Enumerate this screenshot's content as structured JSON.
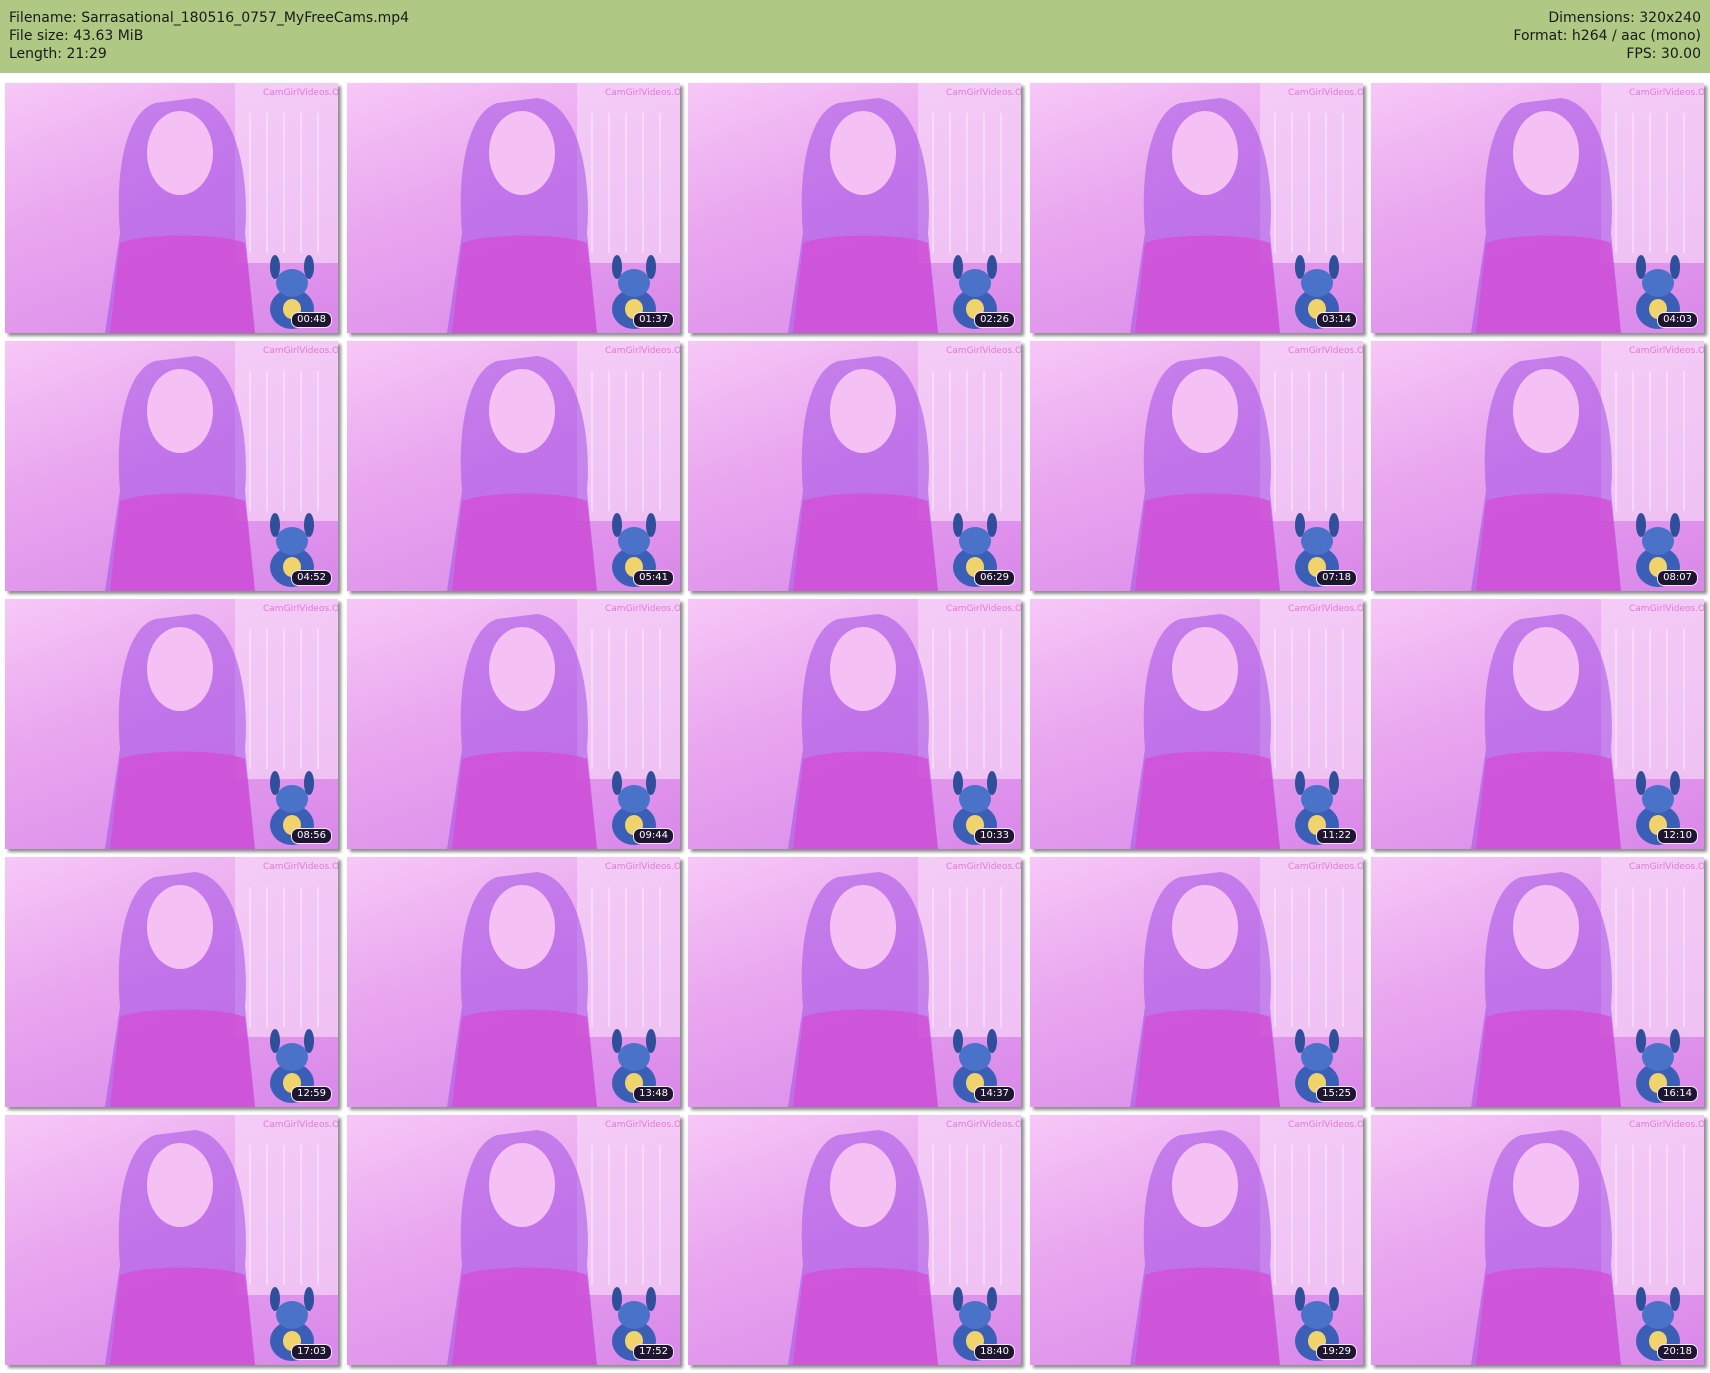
{
  "header": {
    "filename": "Filename: Sarrasational_180516_0757_MyFreeCams.mp4",
    "filesize": "File size: 43.63 MiB",
    "length": "Length: 21:29",
    "dimensions": "Dimensions: 320x240",
    "format": "Format: h264 / aac (mono)",
    "fps": "FPS: 30.00"
  },
  "thumbnails": [
    {
      "time": "00:48"
    },
    {
      "time": "01:37"
    },
    {
      "time": "02:26"
    },
    {
      "time": "03:14"
    },
    {
      "time": "04:03"
    },
    {
      "time": "04:52"
    },
    {
      "time": "05:41"
    },
    {
      "time": "06:29"
    },
    {
      "time": "07:18"
    },
    {
      "time": "08:07"
    },
    {
      "time": "08:56"
    },
    {
      "time": "09:44"
    },
    {
      "time": "10:33"
    },
    {
      "time": "11:22"
    },
    {
      "time": "12:10"
    },
    {
      "time": "12:59"
    },
    {
      "time": "13:48"
    },
    {
      "time": "14:37"
    },
    {
      "time": "15:25"
    },
    {
      "time": "16:14"
    },
    {
      "time": "17:03"
    },
    {
      "time": "17:52"
    },
    {
      "time": "18:40"
    },
    {
      "time": "19:29"
    },
    {
      "time": "20:18"
    }
  ],
  "colors": {
    "header_bg": "#afc984",
    "thumb_bg": "#e9a7ef"
  }
}
